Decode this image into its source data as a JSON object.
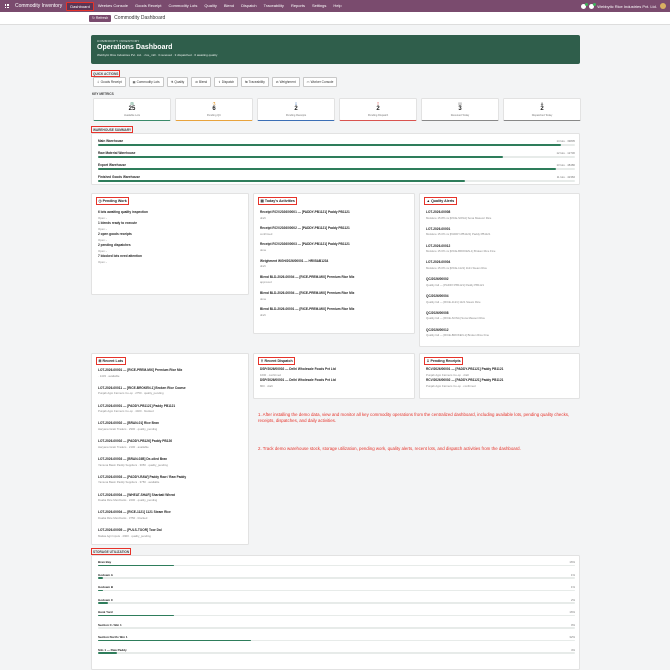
{
  "topnav": {
    "brand": "Commodity Inventory",
    "menu": [
      "Dashboard",
      "Weekes Console",
      "Goods Receipt",
      "Commodity Lots",
      "Quality",
      "Blend",
      "Dispatch",
      "Traceability",
      "Reports",
      "Settings",
      "Help"
    ],
    "company": "Webbytic Rice Industries Pvt. Ltd.",
    "colors": {
      "bar": "#7a4b6e",
      "accent": "#2f5e4b",
      "bar_fill": "#2e7d5b",
      "highlight": "#e6332a"
    }
  },
  "control": {
    "refresh": "Refresh",
    "title": "Commodity Dashboard"
  },
  "hero": {
    "kicker": "COMMODITY INVENTORY",
    "title": "Operations Dashboard",
    "subtitle": "Webbytic Rice Industries Pvt. Ltd. · rice_mill · 3 received · 3 dispatched · 6 awaiting quality"
  },
  "quick_actions": {
    "label": "QUICK ACTIONS",
    "buttons": [
      {
        "icon": "download-icon",
        "glyph": "⇩",
        "label": "Goods Receipt"
      },
      {
        "icon": "grid-icon",
        "glyph": "▦",
        "label": "Commodity Lots"
      },
      {
        "icon": "flask-icon",
        "glyph": "⚗",
        "label": "Quality"
      },
      {
        "icon": "blend-icon",
        "glyph": "⚖",
        "label": "Blend"
      },
      {
        "icon": "truck-icon",
        "glyph": "⇪",
        "label": "Dispatch"
      },
      {
        "icon": "route-icon",
        "glyph": "⇆",
        "label": "Traceability"
      },
      {
        "icon": "scale-icon",
        "glyph": "⚖",
        "label": "Weighment"
      },
      {
        "icon": "monitor-icon",
        "glyph": "▭",
        "label": "Worker Console"
      }
    ]
  },
  "kpi": {
    "label": "KEY METRICS",
    "items": [
      {
        "icon": "box-icon",
        "glyph": "⊞",
        "value": "25",
        "label": "Available Lots",
        "color": "#3a8a6a"
      },
      {
        "icon": "flask-icon",
        "glyph": "⚗",
        "value": "6",
        "label": "Pending QC",
        "color": "#e8a33d"
      },
      {
        "icon": "download-icon",
        "glyph": "⇩",
        "value": "2",
        "label": "Pending Receipts",
        "color": "#3b6fb6"
      },
      {
        "icon": "truck-icon",
        "glyph": "⇪",
        "value": "2",
        "label": "Pending Dispatch",
        "color": "#d9534f"
      },
      {
        "icon": "calendar-icon",
        "glyph": "▤",
        "value": "3",
        "label": "Received Today",
        "color": "#888888"
      },
      {
        "icon": "bell-icon",
        "glyph": "♟",
        "value": "2",
        "label": "Dispatched Today",
        "color": "#888888"
      }
    ]
  },
  "warehouse": {
    "label": "WAREHOUSE SUMMARY",
    "rows": [
      {
        "name": "Main Warehouse",
        "info": "14 lots · 39805",
        "fill": 0.97
      },
      {
        "name": "Raw Material Warehouse",
        "info": "12 lots · 12730",
        "fill": 0.85
      },
      {
        "name": "Export Warehouse",
        "info": "13 lots · 48486",
        "fill": 0.96
      },
      {
        "name": "Finished Goods Warehouse",
        "info": "11 lots · 42360",
        "fill": 0.77
      }
    ]
  },
  "pending": {
    "title": "Pending Work",
    "icon": "clock-icon",
    "items": [
      {
        "a": "6 lots awaiting quality inspection",
        "b": "Open ›"
      },
      {
        "a": "1 blends ready to execute",
        "b": "Open ›"
      },
      {
        "a": "2 open goods receipts",
        "b": "Open ›"
      },
      {
        "a": "2 pending dispatches",
        "b": "Open ›"
      },
      {
        "a": "7 blocked lots need attention",
        "b": "Open ›"
      }
    ]
  },
  "activities": {
    "title": "Today's Activities",
    "icon": "calendar-icon",
    "items": [
      {
        "a": "Receipt RCV/2026/00001 — [PADDY-PB1121] Paddy PB1121",
        "b": "draft"
      },
      {
        "a": "Receipt RCV/2026/00002 — [PADDY-PB1121] Paddy PB1121",
        "b": "confirmed"
      },
      {
        "a": "Receipt RCV/2026/00003 — [PADDY-PB1121] Paddy PB1121",
        "b": "done"
      },
      {
        "a": "Weighment WGH/2026/00001 — HR05AB1234",
        "b": "draft"
      },
      {
        "a": "Blend BLD-2026-00004 — [RICE-PREM-MIX] Premium Rice Mix",
        "b": "approved"
      },
      {
        "a": "Blend BLD-2026-00004 — [RICE-PREM-MIX] Premium Rice Mix",
        "b": "done"
      },
      {
        "a": "Blend BLD-2026-00001 — [RICE-PREM-MIX] Premium Rice Mix",
        "b": "draft"
      }
    ]
  },
  "quality": {
    "title": "Quality Alerts",
    "icon": "warning-icon",
    "items": [
      {
        "a": "LOT-2026-00008",
        "b": "Moisture 15.8% vs [RICE-SONA] Sona Masoori Rice"
      },
      {
        "a": "LOT-2026-00001",
        "b": "Moisture 15.0% vs [PADDY-PB1121] Paddy PB1121"
      },
      {
        "a": "LOT-2026-00012",
        "b": "Moisture 15.6% vs [RICE-BROKEN-1] Broken Rice Fine"
      },
      {
        "a": "LOT-2026-00004",
        "b": "Moisture 15.0% vs [RICE-1121] 1121 Steam Rice"
      },
      {
        "a": "QC/2026/00002",
        "b": "Quality fail — [PADDY-PB1121] Paddy PB1121"
      },
      {
        "a": "QC/2026/00004",
        "b": "Quality fail — [RICE-1121] 1121 Steam Rice"
      },
      {
        "a": "QC/2026/00008",
        "b": "Quality fail — [RICE-SONA] Sona Masoori Rice"
      },
      {
        "a": "QC/2026/00012",
        "b": "Quality fail — [RICE-BROKEN-1] Broken Rice Fine"
      }
    ]
  },
  "lots": {
    "title": "Recent Lots",
    "icon": "box-icon",
    "items": [
      {
        "a": "LOT-2026-00001 — [RICE-PREM-MIX] Premium Rice Mix",
        "b": "· 1433 · available"
      },
      {
        "a": "LOT-2026-00011 — [RICE-BROKEN-1] Broken Rice Coarse",
        "b": "Punjab Agro Farmers Co-op · 2750 · quality_pending"
      },
      {
        "a": "LOT-2026-00001 — [PADDY-PB1121] Paddy PB1121",
        "b": "Punjab Agro Farmers Co-op · 4400 · blocked"
      },
      {
        "a": "LOT-2026-00002 — [BRAN-01] Rice Bran",
        "b": "Haryana Grain Traders · 2900 · quality_pending"
      },
      {
        "a": "LOT-2026-00002 — [PADDY-PB126] Paddy PB126",
        "b": "Haryana Grain Traders · 2100 · available"
      },
      {
        "a": "LOT-2026-00003 — [BRAN-03B] De-oiled Bran",
        "b": "Yamuna Basin Paddy Suppliers · 3050 · quality_pending"
      },
      {
        "a": "LOT-2026-00003 — [PADDY-RAW] Paddy Raw / Raw Paddy",
        "b": "Yamuna Basin Paddy Suppliers · 3750 · available"
      },
      {
        "a": "LOT-2026-00004 — [WHEAT-SHAR] Sharbati Wheat",
        "b": "Doaba Rice Merchants · 2200 · quality_pending"
      },
      {
        "a": "LOT-2026-00004 — [RICE-1121] 1121 Steam Rice",
        "b": "Doaba Rice Merchants · 3750 · blocked"
      },
      {
        "a": "LOT-2026-00005 — [PULS-TOOR] Toor Dal",
        "b": "Malwa Agri Inputs · 2900 · quality_pending"
      }
    ]
  },
  "dispatch": {
    "title": "Recent Dispatch",
    "icon": "truck-icon",
    "items": [
      {
        "a": "DSP/2026/00002 — Delhi Wholesale Foods Pvt Ltd",
        "b": "1600 · confirmed"
      },
      {
        "a": "DSP/2026/00001 — Delhi Wholesale Foods Pvt Ltd",
        "b": "800 · draft"
      }
    ]
  },
  "receipts": {
    "title": "Pending Receipts",
    "icon": "download-icon",
    "items": [
      {
        "a": "RCV/2026/00001 — [PADDY-PB1121] Paddy PB1121",
        "b": "Punjab Agro Farmers Co-op · draft"
      },
      {
        "a": "RCV/2026/00002 — [PADDY-PB1121] Paddy PB1121",
        "b": "Punjab Agro Farmers Co-op · confirmed"
      }
    ]
  },
  "notes": [
    "1. After installing the demo data, view and monitor all key commodity operations from the centralized dashboard, including available lots, pending quality checks, receipts, dispatches, and daily activities.",
    "2. Track demo warehouse stock, storage utilization, pending work, quality alerts, recent lots, and dispatch activities from the dashboard."
  ],
  "storage": {
    "label": "STORAGE UTILIZATION",
    "rows": [
      {
        "name": "Bran Bay",
        "pct": "16%",
        "fill": 0.16
      },
      {
        "name": "Godown A",
        "pct": "1%",
        "fill": 0.01
      },
      {
        "name": "Godown B",
        "pct": "1%",
        "fill": 0.01
      },
      {
        "name": "Godown C",
        "pct": "2%",
        "fill": 0.02
      },
      {
        "name": "Husk Yard",
        "pct": "16%",
        "fill": 0.16
      },
      {
        "name": "Section C / Bin 1",
        "pct": "0%",
        "fill": 0.0
      },
      {
        "name": "Section North / Bin 1",
        "pct": "32%",
        "fill": 0.32
      },
      {
        "name": "Silo 1 — Raw Paddy",
        "pct": "4%",
        "fill": 0.04
      }
    ]
  }
}
